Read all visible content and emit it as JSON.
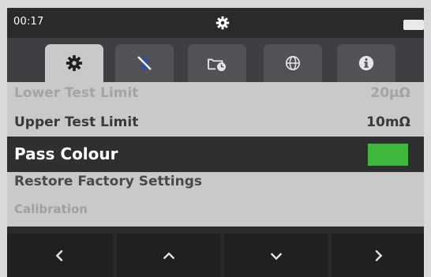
{
  "status_bar": {
    "time": "00:17",
    "center_icon": "gear-icon",
    "battery_icon": "battery-icon"
  },
  "tabs": [
    {
      "icon": "gear-icon",
      "active": true
    },
    {
      "icon": "bluetooth-disabled-icon",
      "active": false
    },
    {
      "icon": "folder-clock-icon",
      "active": false
    },
    {
      "icon": "globe-icon",
      "active": false
    },
    {
      "icon": "info-icon",
      "active": false
    }
  ],
  "settings": {
    "lower_limit": {
      "label": "Lower Test Limit",
      "value": "20μΩ"
    },
    "upper_limit": {
      "label": "Upper Test Limit",
      "value": "10mΩ"
    },
    "pass_colour": {
      "label": "Pass Colour",
      "color": "#3db83d"
    },
    "restore": {
      "label": "Restore Factory Settings"
    },
    "calibration": {
      "label": "Calibration"
    }
  },
  "nav": [
    "chevron-left-icon",
    "chevron-up-icon",
    "chevron-down-icon",
    "chevron-right-icon"
  ],
  "colors": {
    "background": "#d9d9d9",
    "device": "#2a2a2c",
    "list": "#c9c9c9",
    "selected_row": "#2e2f31",
    "pass_green": "#3db83d"
  }
}
